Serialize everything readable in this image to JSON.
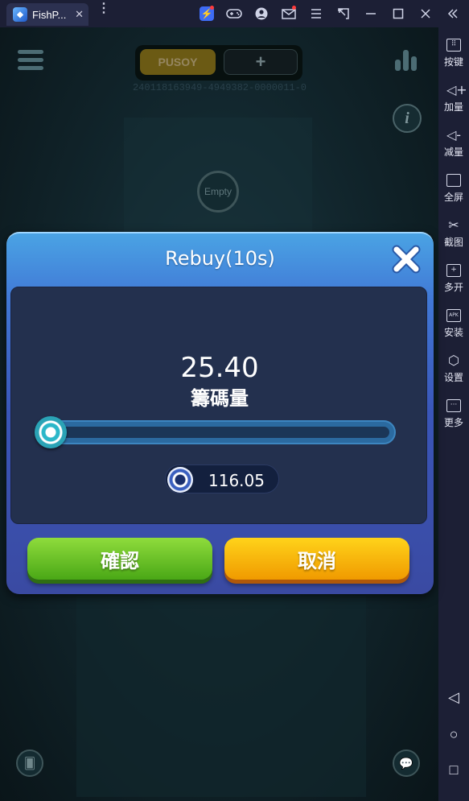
{
  "window": {
    "tab_title": "FishP...",
    "tab_close": "✕",
    "menu_dots": "⋮"
  },
  "titlebar_icons": [
    "bolt-icon",
    "gamepad-icon",
    "user-icon",
    "mail-icon",
    "menu-icon",
    "restore-icon",
    "minimize-icon",
    "maximize-icon",
    "close-icon",
    "collapse-icon"
  ],
  "sidebar": {
    "items": [
      {
        "label": "按键",
        "icon": "keyboard-icon"
      },
      {
        "label": "加量",
        "icon": "volume-up-icon"
      },
      {
        "label": "减量",
        "icon": "volume-down-icon"
      },
      {
        "label": "全屏",
        "icon": "fullscreen-icon"
      },
      {
        "label": "截图",
        "icon": "scissors-icon"
      },
      {
        "label": "多开",
        "icon": "multi-instance-icon"
      },
      {
        "label": "安装",
        "icon": "apk-install-icon"
      },
      {
        "label": "设置",
        "icon": "settings-icon"
      },
      {
        "label": "更多",
        "icon": "more-icon"
      }
    ],
    "nav": [
      "back-icon",
      "home-icon",
      "recents-icon"
    ]
  },
  "game": {
    "tab_pusoy": "PUSOY",
    "tab_plus": "+",
    "game_id": "240118163949-4949382-0000011-0",
    "info": "i",
    "empty_seat": "Empty"
  },
  "dialog": {
    "title": "Rebuy(10s)",
    "amount": "25.40",
    "amount_label": "籌碼量",
    "slider_fraction": 0.0,
    "balance": "116.05",
    "confirm": "確認",
    "cancel": "取消"
  },
  "colors": {
    "confirm_button": "#6cc428",
    "cancel_button": "#f7b500",
    "dialog_blue": "#4179d6"
  }
}
